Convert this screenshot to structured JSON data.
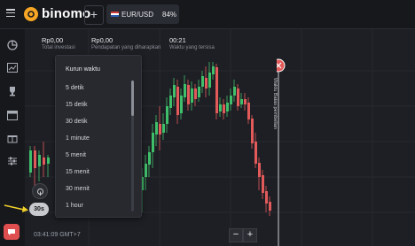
{
  "header": {
    "logo_text": "binomo",
    "add_label": "+",
    "asset": {
      "pair": "EUR/USD",
      "percent": "84%"
    }
  },
  "info": {
    "investment": {
      "value": "Rp0,00",
      "label": "Total investasi"
    },
    "expected": {
      "value": "Rp0,00",
      "label": "Pendapatan yang diharapkan"
    },
    "time_left": {
      "value": "00:21",
      "label": "Waktu yang tersisa"
    }
  },
  "timeframe_menu": {
    "title": "Kurun waktu",
    "options": [
      "5 detik",
      "15 detik",
      "30 detik",
      "1 minute",
      "5 menit",
      "15 menit",
      "30 menit",
      "1 hour"
    ]
  },
  "chart": {
    "timeframe_button": "30s",
    "clock": "03:41:09 GMT+7",
    "zoom_minus": "−",
    "zoom_plus": "+",
    "finish_label": "Waktu Batas pembelian",
    "close_marker": "✕"
  },
  "colors": {
    "up": "#3fbf6a",
    "down": "#e35a5a",
    "accent": "#f6a524"
  },
  "sidebar_icons": [
    "chart-icon",
    "analytics-icon",
    "trophy-icon",
    "calendar-icon",
    "gift-icon",
    "settings-icon"
  ]
}
